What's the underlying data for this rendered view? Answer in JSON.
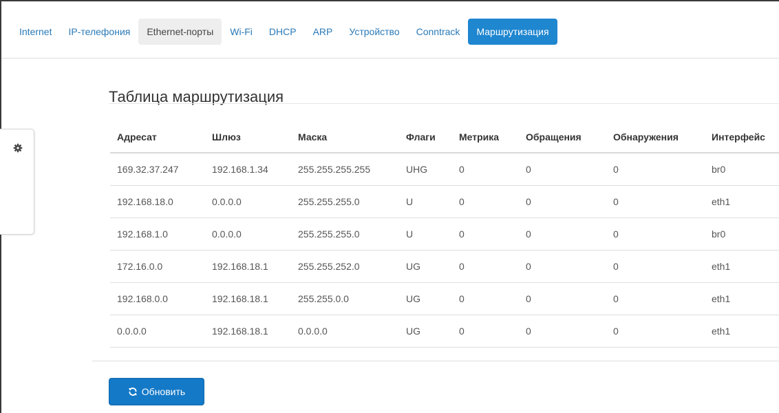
{
  "tabs": [
    {
      "label": "Internet",
      "state": "normal"
    },
    {
      "label": "IP-телефония",
      "state": "normal"
    },
    {
      "label": "Ethernet-порты",
      "state": "hover"
    },
    {
      "label": "Wi-Fi",
      "state": "normal"
    },
    {
      "label": "DHCP",
      "state": "normal"
    },
    {
      "label": "ARP",
      "state": "normal"
    },
    {
      "label": "Устройство",
      "state": "normal"
    },
    {
      "label": "Conntrack",
      "state": "normal"
    },
    {
      "label": "Маршрутизация",
      "state": "active"
    }
  ],
  "side_panel": {
    "icon": "gear-icon"
  },
  "page": {
    "title": "Таблица маршрутизация"
  },
  "table": {
    "columns": [
      "Адресат",
      "Шлюз",
      "Маска",
      "Флаги",
      "Метрика",
      "Обращения",
      "Обнаружения",
      "Интерфейс"
    ],
    "rows": [
      [
        "169.32.37.247",
        "192.168.1.34",
        "255.255.255.255",
        "UHG",
        "0",
        "0",
        "0",
        "br0"
      ],
      [
        "192.168.18.0",
        "0.0.0.0",
        "255.255.255.0",
        "U",
        "0",
        "0",
        "0",
        "eth1"
      ],
      [
        "192.168.1.0",
        "0.0.0.0",
        "255.255.255.0",
        "U",
        "0",
        "0",
        "0",
        "br0"
      ],
      [
        "172.16.0.0",
        "192.168.18.1",
        "255.255.252.0",
        "UG",
        "0",
        "0",
        "0",
        "eth1"
      ],
      [
        "192.168.0.0",
        "192.168.18.1",
        "255.255.0.0",
        "UG",
        "0",
        "0",
        "0",
        "eth1"
      ],
      [
        "0.0.0.0",
        "192.168.18.1",
        "0.0.0.0",
        "UG",
        "0",
        "0",
        "0",
        "eth1"
      ]
    ]
  },
  "actions": {
    "refresh_label": "Обновить",
    "refresh_icon": "refresh-icon"
  },
  "colors": {
    "accent": "#1f86d0",
    "button": "#1479c7",
    "link": "#2a7ab8"
  }
}
